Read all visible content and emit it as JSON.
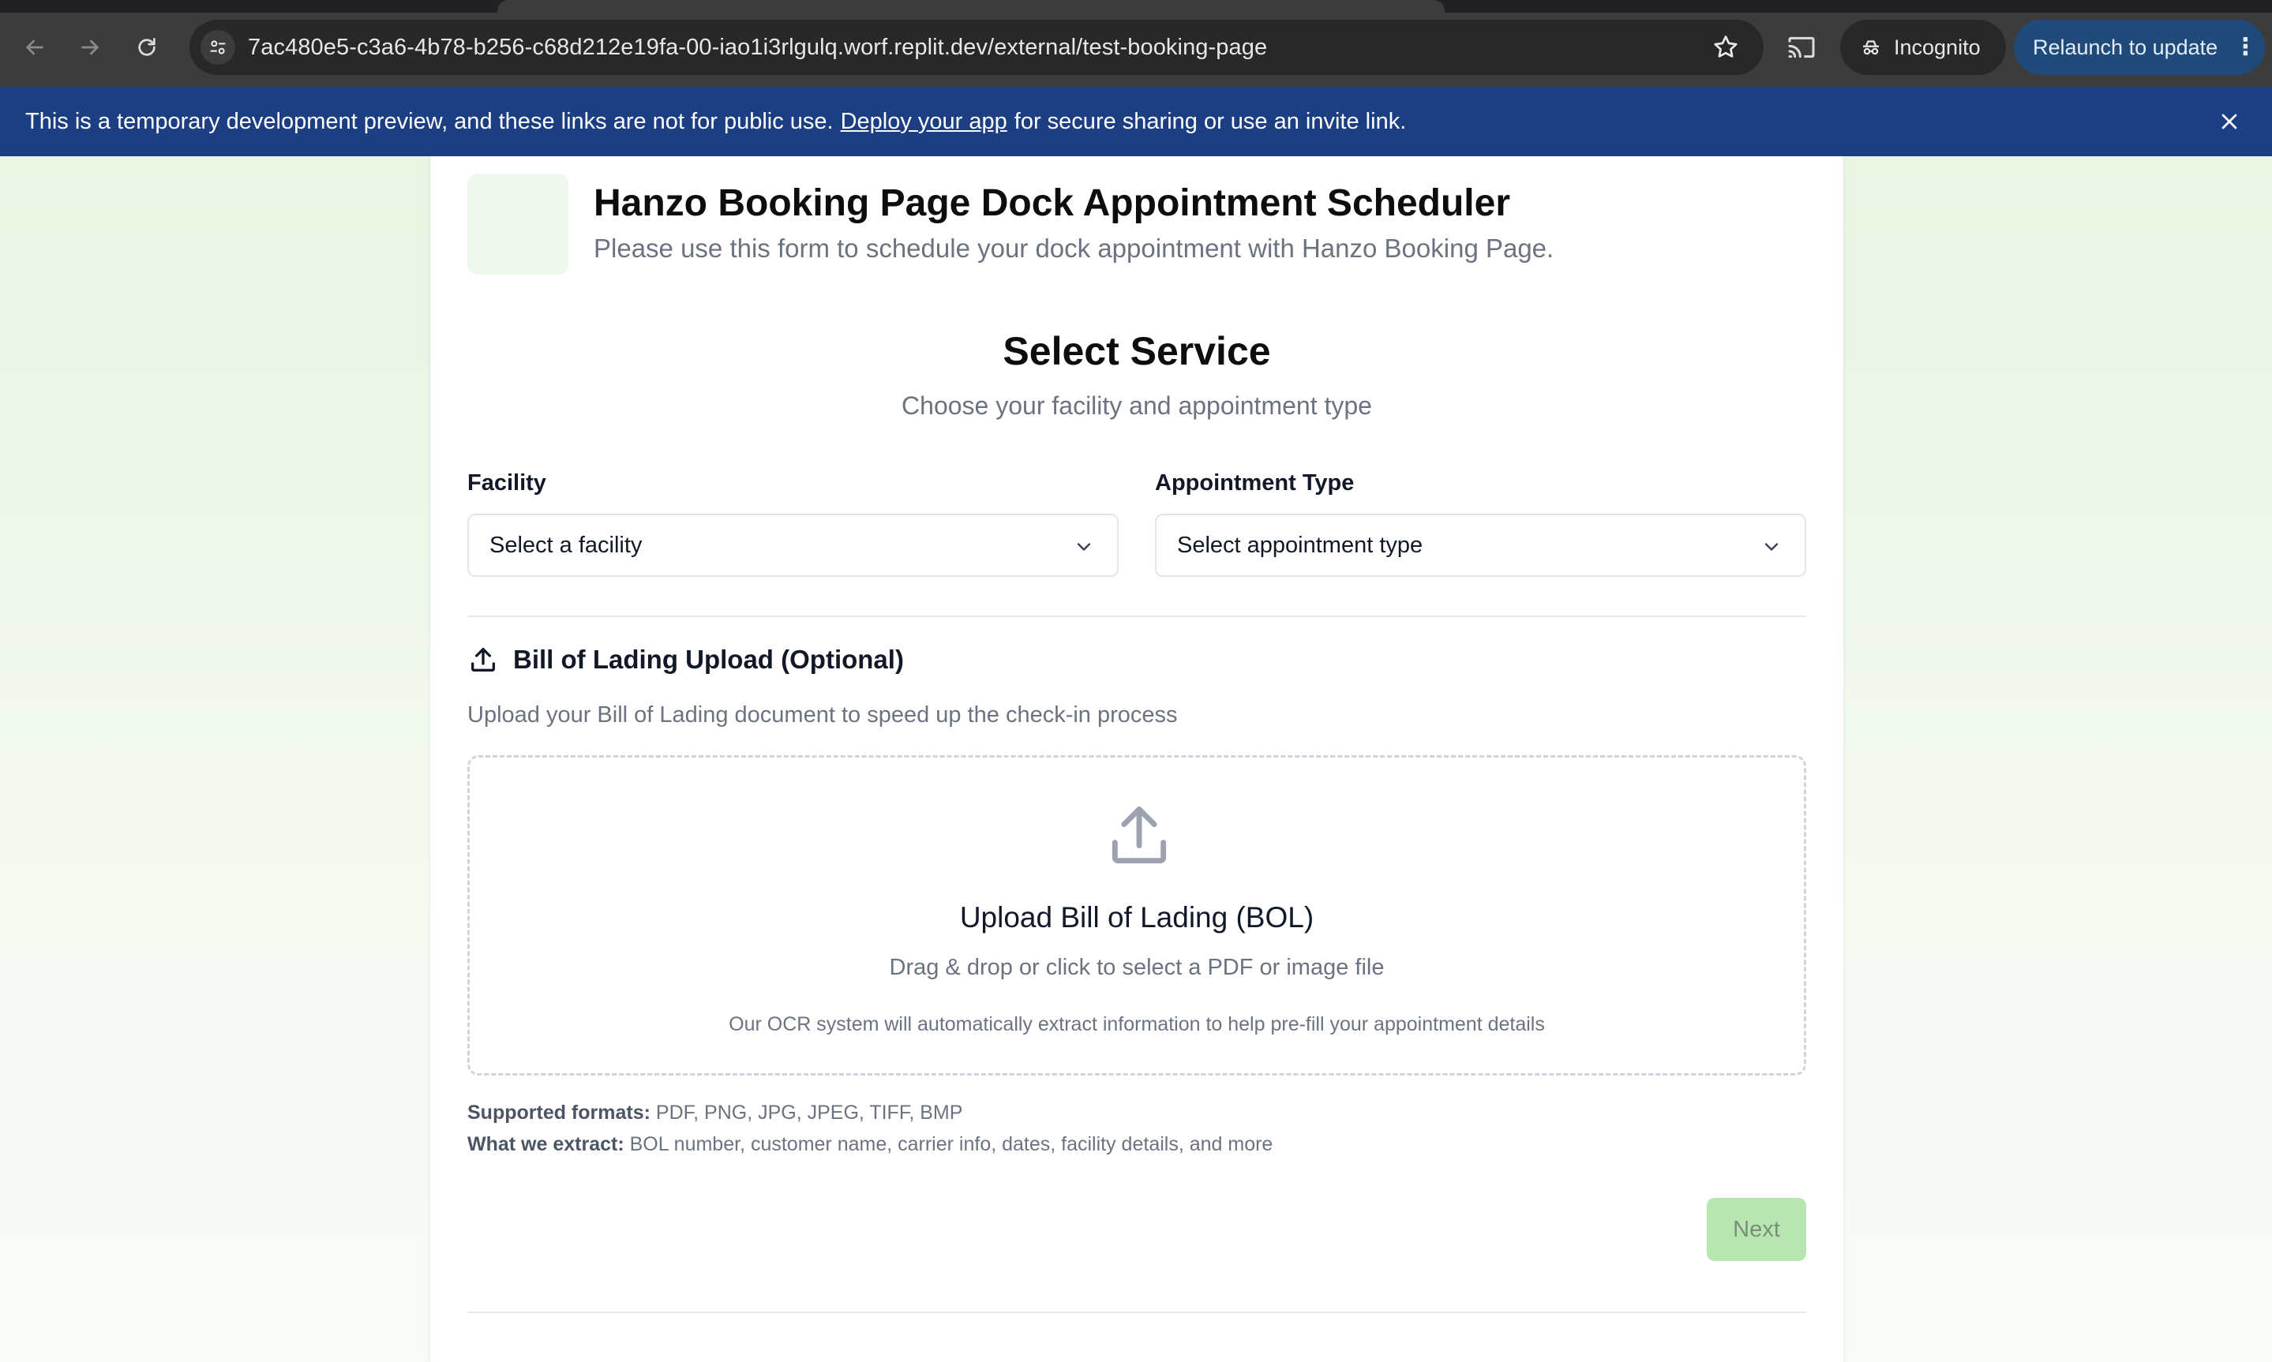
{
  "browser": {
    "url": "7ac480e5-c3a6-4b78-b256-c68d212e19fa-00-iao1i3rlgulq.worf.replit.dev/external/test-booking-page",
    "incognito_label": "Incognito",
    "relaunch_label": "Relaunch to update"
  },
  "banner": {
    "text_before": "This is a temporary development preview, and these links are not for public use.",
    "link_text": "Deploy your app",
    "text_after": "for secure sharing or use an invite link."
  },
  "header": {
    "title": "Hanzo Booking Page Dock Appointment Scheduler",
    "subtitle": "Please use this form to schedule your dock appointment with Hanzo Booking Page."
  },
  "step": {
    "title": "Select Service",
    "subtitle": "Choose your facility and appointment type"
  },
  "form": {
    "facility_label": "Facility",
    "facility_value": "Select a facility",
    "appointment_label": "Appointment Type",
    "appointment_value": "Select appointment type"
  },
  "bol": {
    "heading": "Bill of Lading Upload (Optional)",
    "description": "Upload your Bill of Lading document to speed up the check-in process",
    "dropzone_title": "Upload Bill of Lading (BOL)",
    "dropzone_sub": "Drag & drop or click to select a PDF or image file",
    "dropzone_note": "Our OCR system will automatically extract information to help pre-fill your appointment details",
    "formats_label": "Supported formats:",
    "formats_value": "PDF, PNG, JPG, JPEG, TIFF, BMP",
    "extract_label": "What we extract:",
    "extract_value": "BOL number, customer name, carrier info, dates, facility details, and more"
  },
  "actions": {
    "next_label": "Next"
  },
  "colors": {
    "banner": "#1b3f82",
    "next_disabled": "#b7e7b0",
    "relaunch": "#1f4a7a"
  }
}
